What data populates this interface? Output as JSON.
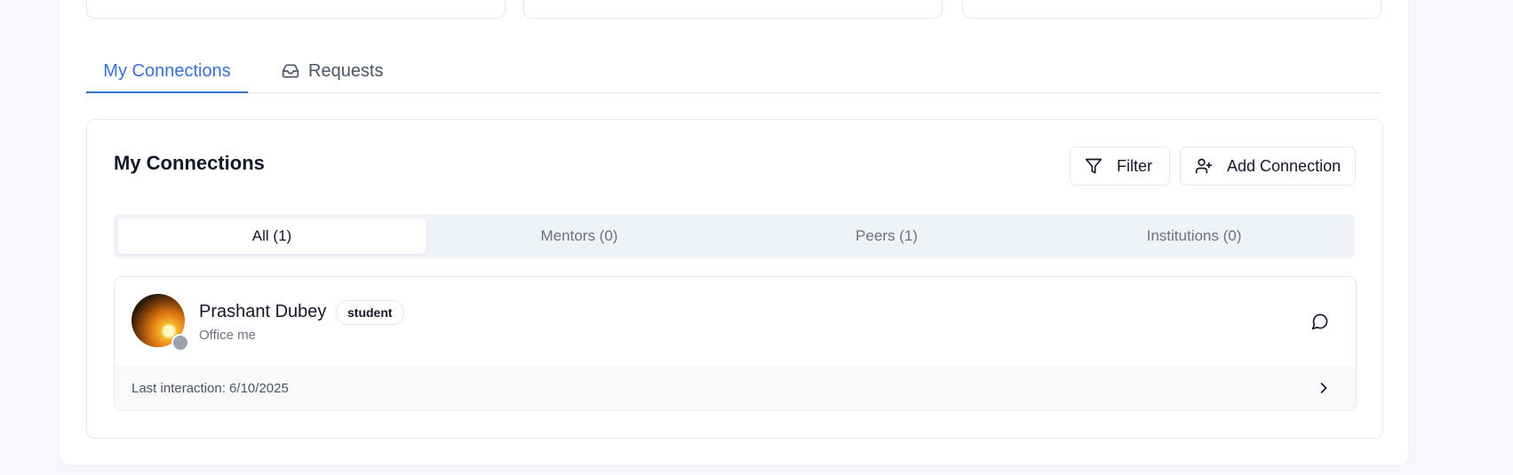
{
  "tabs": [
    {
      "label": "My Connections",
      "icon": "",
      "active": true
    },
    {
      "label": "Requests",
      "icon": "inbox-icon",
      "active": false
    }
  ],
  "card": {
    "title": "My Connections",
    "filter_label": "Filter",
    "add_label": "Add Connection"
  },
  "segments": [
    {
      "label": "All (1)",
      "active": true
    },
    {
      "label": "Mentors (0)",
      "active": false
    },
    {
      "label": "Peers (1)",
      "active": false
    },
    {
      "label": "Institutions (0)",
      "active": false
    }
  ],
  "connection": {
    "name": "Prashant Dubey",
    "role": "student",
    "subtitle": "Office me",
    "last_interaction": "Last interaction: 6/10/2025"
  },
  "colors": {
    "accent": "#3b6fd8",
    "danger": "#ef4444",
    "muted": "#6b7280"
  }
}
